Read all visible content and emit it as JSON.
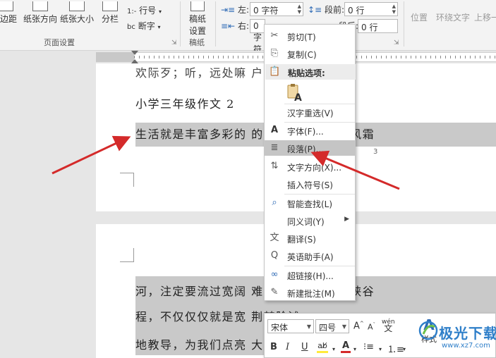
{
  "ribbon": {
    "margins_label": "页边距",
    "orientation_label": "纸张方向",
    "size_label": "纸张大小",
    "columns_label": "分栏",
    "line_numbers_label": "行号",
    "hyphenation_label": "断字",
    "page_setup_group": "页面设置",
    "draft_label_line1": "稿纸",
    "draft_label_line2": "设置",
    "draft_group": "稿纸",
    "indent_left_label": "左:",
    "indent_left_value": "0 字符",
    "indent_right_label": "右:",
    "indent_right_value": "0 字符",
    "spacing_before_label": "段前:",
    "spacing_before_value": "0 行",
    "spacing_after_label": "段后:",
    "spacing_after_value": "0 行",
    "position_label": "位置",
    "wrap_text_label": "环绕文字",
    "bring_forward_label": "上移一"
  },
  "document": {
    "top_line": "欢际歹；听，远处嘛                户义响起了。",
    "heading": "小学三年级作文 2",
    "para_line1": "生活就是丰富多彩的           的阳光，也弥漫着风霜",
    "page_number": "3",
    "p2_line1": "河，注定要流过宽阔            难免要经过险峻的峡谷",
    "p2_line2": "程，不仅仅仅就是宽                      荆棘险滩",
    "p2_line3": "地教导，为我们点亮                      大的太阳"
  },
  "context_menu": {
    "items": [
      {
        "label": "剪切(T)",
        "icon": "scissors-icon"
      },
      {
        "label": "复制(C)",
        "icon": "copy-icon"
      },
      {
        "label": "粘贴选项:",
        "icon": "paste-icon"
      },
      {
        "label": "汉字重选(V)",
        "icon": ""
      },
      {
        "label": "字体(F)...",
        "icon": "font-icon"
      },
      {
        "label": "段落(P)...",
        "icon": "paragraph-icon"
      },
      {
        "label": "文字方向(X)...",
        "icon": "text-direction-icon"
      },
      {
        "label": "插入符号(S)",
        "icon": ""
      },
      {
        "label": "智能查找(L)",
        "icon": "smart-lookup-icon"
      },
      {
        "label": "同义词(Y)",
        "icon": ""
      },
      {
        "label": "翻译(S)",
        "icon": "translate-icon"
      },
      {
        "label": "英语助手(A)",
        "icon": "english-assistant-icon"
      },
      {
        "label": "超链接(H)...",
        "icon": "hyperlink-icon"
      },
      {
        "label": "新建批注(M)",
        "icon": "new-comment-icon"
      }
    ]
  },
  "mini_toolbar": {
    "font_name": "宋体",
    "font_size": "四号",
    "styles_label": "样式",
    "bold": "B",
    "italic": "I",
    "underline": "U"
  },
  "watermark": {
    "title": "极光下载站",
    "url": "www.xz7.com"
  },
  "colors": {
    "arrow": "#d42a2a",
    "highlight": "#c9c9c9",
    "menu_hover": "#c5c5c5",
    "watermark": "#2f7fc9"
  }
}
